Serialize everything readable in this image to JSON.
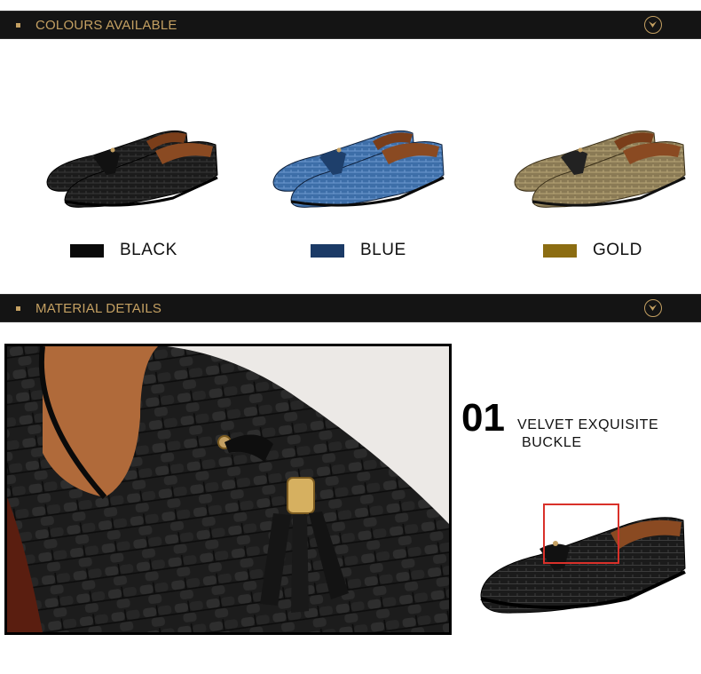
{
  "colours_section": {
    "title": "COLOURS AVAILABLE",
    "accent": "#c4a062",
    "options": [
      {
        "label": "BLACK",
        "swatch": "#0a0a0a",
        "shoe_tone": "#1a1a1a"
      },
      {
        "label": "BLUE",
        "swatch": "#1b3a66",
        "shoe_tone": "#3d6ea8"
      },
      {
        "label": "GOLD",
        "swatch": "#8c6d12",
        "shoe_tone": "#8a7a55"
      }
    ]
  },
  "material_section": {
    "title": "MATERIAL DETAILS",
    "feature_number": "01",
    "feature_line1": "VELVET  EXQUISITE",
    "feature_line2": "BUCKLE"
  },
  "icons": {
    "banner_arrow": "chevron-down-circle-icon"
  }
}
